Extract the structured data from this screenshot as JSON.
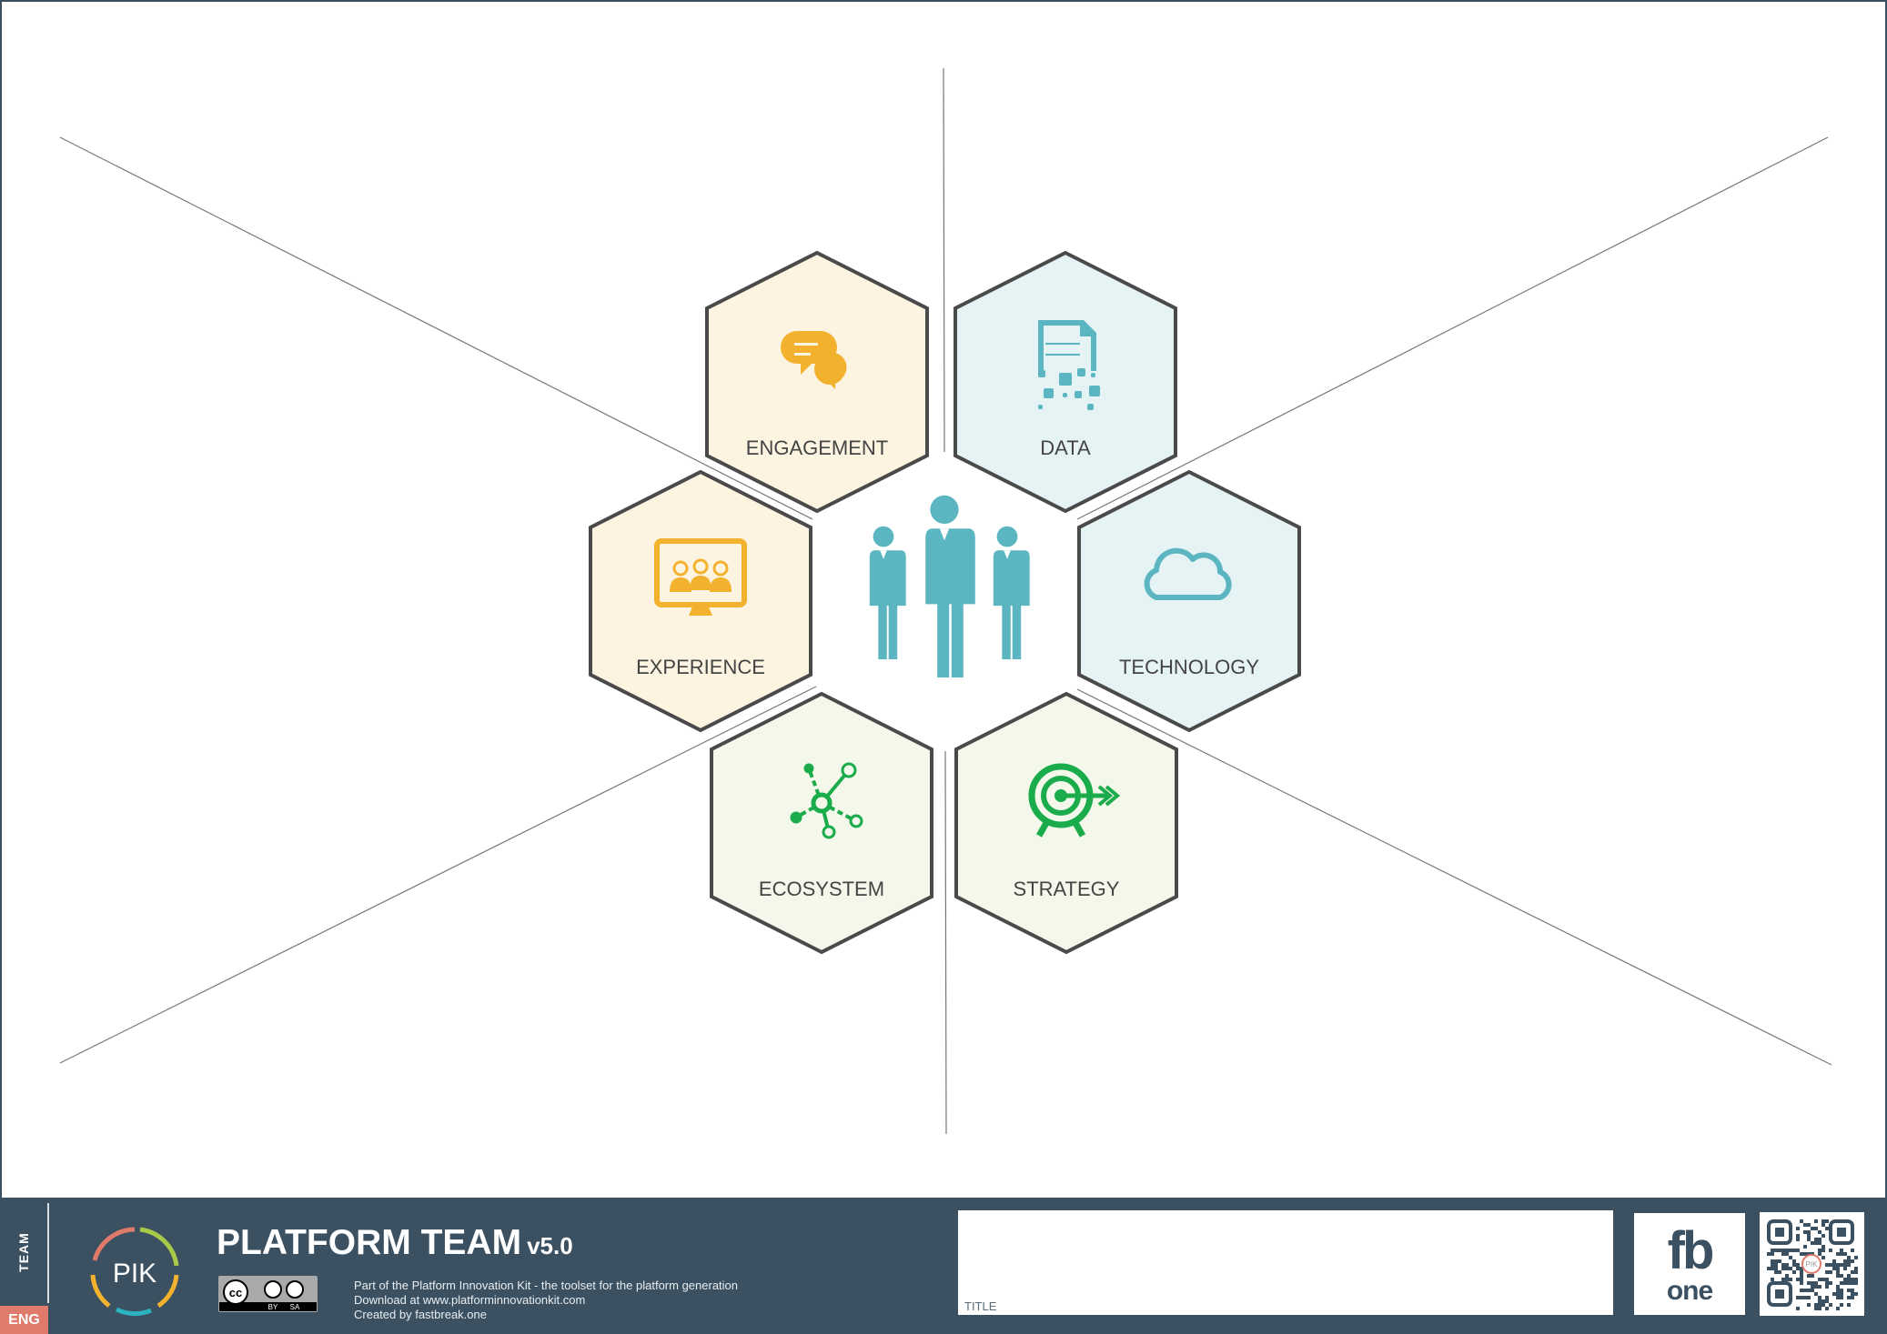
{
  "canvas": {
    "segments": [
      {
        "label": "ENGAGEMENT",
        "icon": "chat-bubbles-icon",
        "fill": "#fcf3e0",
        "icon_color": "#f3b22e"
      },
      {
        "label": "DATA",
        "icon": "data-document-icon",
        "fill": "#e5f3f4",
        "icon_color": "#5bb6c1"
      },
      {
        "label": "EXPERIENCE",
        "icon": "screen-users-icon",
        "fill": "#fcf3e0",
        "icon_color": "#f3b22e"
      },
      {
        "label": "TECHNOLOGY",
        "icon": "cloud-icon",
        "fill": "#e5f3f4",
        "icon_color": "#5bb6c1"
      },
      {
        "label": "ECOSYSTEM",
        "icon": "network-icon",
        "fill": "#f3f8ea",
        "icon_color": "#1aab4b"
      },
      {
        "label": "STRATEGY",
        "icon": "target-icon",
        "fill": "#f3f8ea",
        "icon_color": "#1aab4b"
      }
    ],
    "center_icon": "team-people-icon",
    "center_color": "#5bb6c1",
    "hex_stroke": "#4a4a4a"
  },
  "footer": {
    "side_label": "TEAM",
    "language": "ENG",
    "logo_text": "PIK",
    "title": "PLATFORM TEAM",
    "version": "v5.0",
    "license": {
      "by": "BY",
      "sa": "SA"
    },
    "info": [
      "Part of the Platform Innovation Kit  - the toolset for the platform generation",
      "Download at www.platforminnovationkit.com",
      "Created by fastbreak.one"
    ],
    "title_field_label": "TITLE",
    "brand_logo": {
      "top": "fb",
      "bottom": "one"
    },
    "qr_center": "PIK",
    "colors": {
      "background": "#3b5060",
      "language_badge": "#e07a6b"
    }
  }
}
